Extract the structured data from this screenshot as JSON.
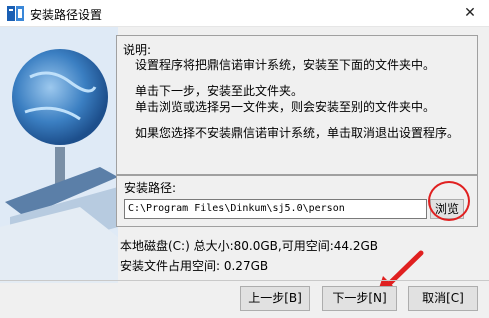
{
  "window": {
    "title": "安装路径设置",
    "close_glyph": "✕"
  },
  "description": {
    "title": "说明:",
    "lines": [
      "设置程序将把鼎信诺审计系统，安装至下面的文件夹中。",
      "单击下一步，安装至此文件夹。",
      "单击浏览或选择另一文件夹，则会安装至别的文件夹中。",
      "如果您选择不安装鼎信诺审计系统，单击取消退出设置程序。"
    ]
  },
  "install_path": {
    "label": "安装路径:",
    "value": "C:\\Program Files\\Dinkum\\sj5.0\\person",
    "browse_label": "浏览"
  },
  "disk": {
    "info": "本地磁盘(C:) 总大小:80.0GB,可用空间:44.2GB",
    "space_used": "安装文件占用空间: 0.27GB"
  },
  "buttons": {
    "back": "上一步[B]",
    "next": "下一步[N]",
    "cancel": "取消[C]"
  },
  "colors": {
    "annotation": "#e02020",
    "dialog_bg": "#f0f0f0"
  }
}
